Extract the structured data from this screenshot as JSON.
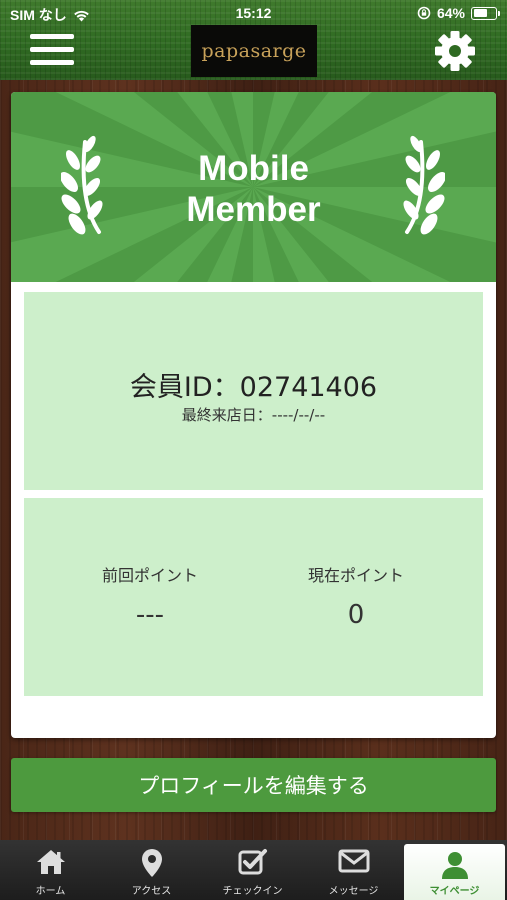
{
  "status_bar": {
    "carrier": "SIM なし",
    "time": "15:12",
    "battery_percent": "64%",
    "battery_level": 0.64
  },
  "header": {
    "logo_text": "papasarge"
  },
  "banner": {
    "title": "Mobile\nMember"
  },
  "member": {
    "id_label": "会員ID：02741406",
    "last_visit": "最終来店日：----/--/--"
  },
  "points": {
    "previous_label": "前回ポイント",
    "previous_value": "---",
    "current_label": "現在ポイント",
    "current_value": "0"
  },
  "edit_profile_label": "プロフィールを編集する",
  "tabs": [
    {
      "label": "ホーム",
      "icon": "home-icon"
    },
    {
      "label": "アクセス",
      "icon": "map-pin-icon"
    },
    {
      "label": "チェックイン",
      "icon": "checkbox-icon"
    },
    {
      "label": "メッセージ",
      "icon": "envelope-icon"
    },
    {
      "label": "マイページ",
      "icon": "user-icon",
      "active": true
    }
  ],
  "colors": {
    "header_green": "#2f6a22",
    "banner_green": "#4e9a45",
    "panel_green": "#cdefcb",
    "button_green": "#4d9a3e",
    "logo_gold": "#c8a25a"
  }
}
